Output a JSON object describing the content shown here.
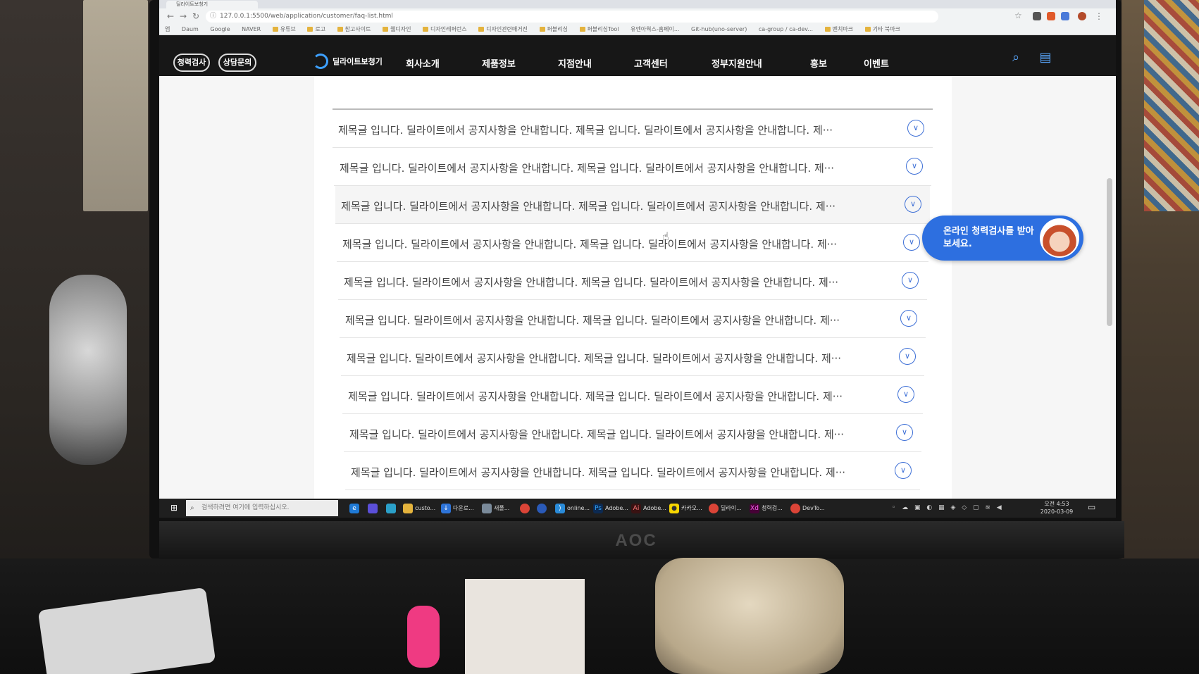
{
  "browser": {
    "tab_title": "딜라이트보청기",
    "url": "127.0.0.1:5500/web/application/customer/faq-list.html",
    "bookmarks": [
      "앱",
      "Daum",
      "Google",
      "NAVER",
      "유튜브",
      "로고",
      "참고사이트",
      "웹디자인",
      "디자인레퍼런스",
      "디자인관련매거진",
      "퍼블리싱",
      "퍼블리싱Tool",
      "유엔아웍스-홈페이...",
      "Git-hub(uno-server)",
      "ca-group / ca-dev...",
      "벤치마크"
    ],
    "other_bookmarks": "기타 북마크"
  },
  "header": {
    "pill_hearing_test": "청력검사",
    "pill_consult": "상담문의",
    "logo_text": "딜라이트보청기",
    "menu": [
      "회사소개",
      "제품정보",
      "지점안내",
      "고객센터",
      "정부지원안내",
      "홍보",
      "이벤트"
    ]
  },
  "faq": {
    "items": [
      "제목글 입니다. 딜라이트에서 공지사항을 안내합니다. 제목글 입니다. 딜라이트에서 공지사항을 안내합니다. 제···",
      "제목글 입니다. 딜라이트에서 공지사항을 안내합니다. 제목글 입니다. 딜라이트에서 공지사항을 안내합니다. 제···",
      "제목글 입니다. 딜라이트에서 공지사항을 안내합니다. 제목글 입니다. 딜라이트에서 공지사항을 안내합니다. 제···",
      "제목글 입니다. 딜라이트에서 공지사항을 안내합니다. 제목글 입니다. 딜라이트에서 공지사항을 안내합니다. 제···",
      "제목글 입니다. 딜라이트에서 공지사항을 안내합니다. 제목글 입니다. 딜라이트에서 공지사항을 안내합니다. 제···",
      "제목글 입니다. 딜라이트에서 공지사항을 안내합니다. 제목글 입니다. 딜라이트에서 공지사항을 안내합니다. 제···",
      "제목글 입니다. 딜라이트에서 공지사항을 안내합니다. 제목글 입니다. 딜라이트에서 공지사항을 안내합니다. 제···",
      "제목글 입니다. 딜라이트에서 공지사항을 안내합니다. 제목글 입니다. 딜라이트에서 공지사항을 안내합니다. 제···",
      "제목글 입니다. 딜라이트에서 공지사항을 안내합니다. 제목글 입니다. 딜라이트에서 공지사항을 안내합니다. 제···",
      "제목글 입니다. 딜라이트에서 공지사항을 안내합니다. 제목글 입니다. 딜라이트에서 공지사항을 안내합니다. 제···"
    ],
    "chevron_icon": "chevron-down-circle-icon"
  },
  "cta": {
    "text": "온라인 청력검사를 받아보세요."
  },
  "taskbar": {
    "search_placeholder": "검색하려면 여기에 입력하십시오.",
    "apps": [
      "custo...",
      "다운로...",
      "새폴...",
      "online...",
      "Adobe...",
      "Adobe...",
      "카카오...",
      "딜라이...",
      "청력검...",
      "DevTo..."
    ],
    "time": "오전 4:53",
    "date": "2020-03-09"
  },
  "monitor": {
    "brand": "AOC"
  },
  "colors": {
    "header_bg": "#171717",
    "accent_blue": "#2d6fe0",
    "chevron_blue": "#3d6fd6"
  }
}
